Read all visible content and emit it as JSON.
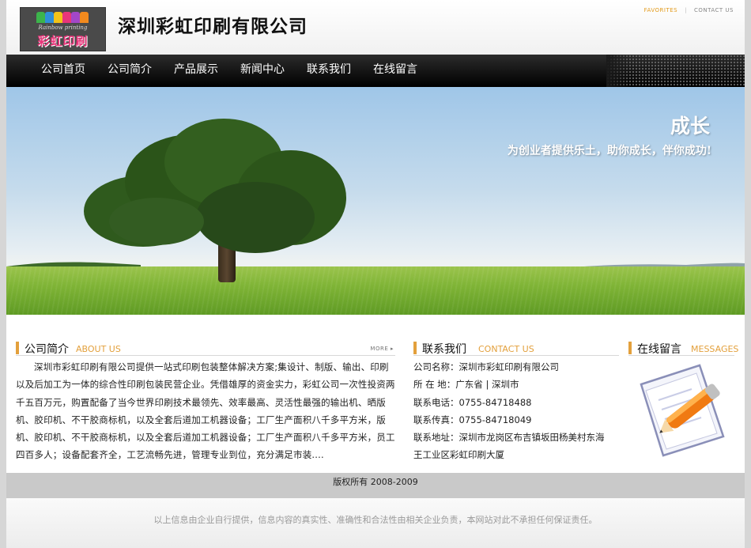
{
  "header": {
    "logo_en": "Rainbow printing",
    "logo_cn": "彩虹印刷",
    "company_name": "深圳彩虹印刷有限公司",
    "favorites": "FAVORITES",
    "contact_us": "CONTACT US",
    "logo_colors": [
      "#3cb44b",
      "#2f8fd8",
      "#f2c318",
      "#e8357a",
      "#e8357a",
      "#f28a1e"
    ]
  },
  "nav": {
    "items": [
      "公司首页",
      "公司简介",
      "产品展示",
      "新闻中心",
      "联系我们",
      "在线留言"
    ]
  },
  "banner": {
    "title": "成长",
    "subtitle": "为创业者提供乐土，助你成长，伴你成功!"
  },
  "about": {
    "title_cn": "公司简介",
    "title_en": "ABOUT US",
    "more": "MORE ▸",
    "text": "深圳市彩虹印刷有限公司提供一站式印刷包装整体解决方案;集设计、制版、输出、印刷以及后加工为一体的综合性印刷包装民营企业。凭借雄厚的资金实力，彩虹公司一次性投资两千五百万元，购置配备了当今世界印刷技术最领先、效率最高、灵活性最强的输出机、晒版机、胶印机、不干胶商标机，以及全套后道加工机器设备；工厂生产面积八千多平方米，版机、胶印机、不干胶商标机，以及全套后道加工机器设备；工厂生产面积八千多平方米，员工四百多人；设备配套齐全，工艺流畅先进，管理专业到位，充分满足市装...."
  },
  "contact": {
    "title_cn": "联系我们",
    "title_en": "CONTACT US",
    "rows": [
      "公司名称：深圳市彩虹印刷有限公司",
      "所 在 地：广东省 | 深圳市",
      "联系电话：0755-84718488",
      "联系传真：0755-84718049",
      "联系地址：深圳市龙岗区布吉镇坂田杨美村东海",
      "王工业区彩虹印刷大厦"
    ]
  },
  "messages": {
    "title_cn": "在线留言",
    "title_en": "MESSAGES"
  },
  "footer": {
    "copyright": "版权所有 2008-2009",
    "disclaimer": "以上信息由企业自行提供，信息内容的真实性、准确性和合法性由相关企业负责，本网站对此不承担任何保证责任。"
  },
  "colors": {
    "accent": "#e3a03c",
    "nav_bg": "#111111"
  }
}
